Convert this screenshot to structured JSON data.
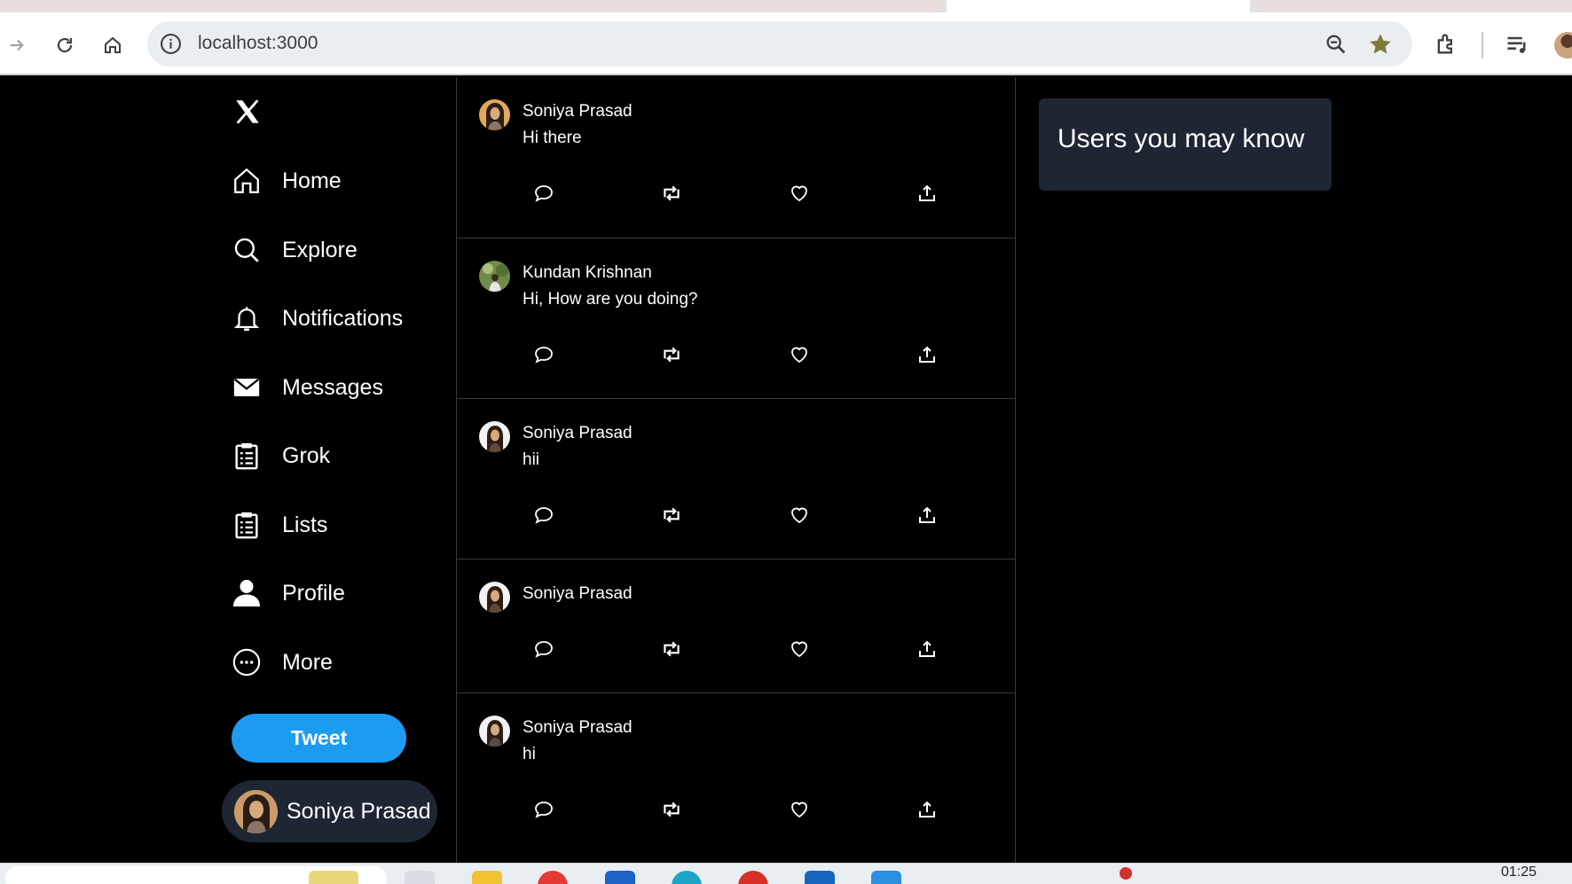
{
  "browser": {
    "url": "localhost:3000"
  },
  "sidebar": {
    "items": [
      {
        "label": "Home",
        "icon": "home-icon"
      },
      {
        "label": "Explore",
        "icon": "search-icon"
      },
      {
        "label": "Notifications",
        "icon": "bell-icon"
      },
      {
        "label": "Messages",
        "icon": "mail-icon"
      },
      {
        "label": "Grok",
        "icon": "clipboard-icon"
      },
      {
        "label": "Lists",
        "icon": "list-icon"
      },
      {
        "label": "Profile",
        "icon": "person-icon"
      },
      {
        "label": "More",
        "icon": "more-icon"
      }
    ],
    "tweet_label": "Tweet",
    "user_name": "Soniya Prasad"
  },
  "feed": {
    "tweets": [
      {
        "author": "Soniya Prasad",
        "text": "Hi there"
      },
      {
        "author": "Kundan Krishnan",
        "text": "Hi, How are you doing?"
      },
      {
        "author": "Soniya Prasad",
        "text": "hii"
      },
      {
        "author": "Soniya Prasad",
        "text": ""
      },
      {
        "author": "Soniya Prasad",
        "text": "hi"
      }
    ]
  },
  "right_panel": {
    "title": "Users you may know"
  },
  "taskbar": {
    "time": "01:25"
  },
  "colors": {
    "accent": "#1d9bf0",
    "card": "#1e2533",
    "background": "#000000"
  }
}
